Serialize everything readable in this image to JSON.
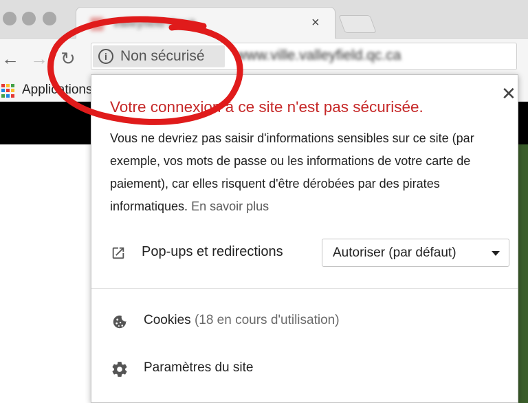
{
  "window": {
    "tab_title": "Valleyfield Capit",
    "tab_close_glyph": "×"
  },
  "toolbar": {
    "back_glyph": "←",
    "forward_glyph": "→",
    "reload_glyph": "↻",
    "security_chip_icon": "info-icon",
    "security_chip_label": "Non sécurisé",
    "url": "www.ville.valleyfield.qc.ca"
  },
  "bookmarks": {
    "apps_label": "Applications"
  },
  "popup": {
    "close_glyph": "✕",
    "title": "Votre connexion à ce site n'est pas sécurisée.",
    "body": "Vous ne devriez pas saisir d'informations sensibles sur ce site (par exemple, vos mots de passe ou les informations de votre carte de paiement), car elles risquent d'être dérobées par des pirates informatiques.",
    "learn_more": "En savoir plus",
    "permission": {
      "icon": "external-link-icon",
      "label": "Pop-ups et redirections",
      "value": "Autoriser (par défaut)"
    },
    "items": [
      {
        "icon": "cookie-icon",
        "label": "Cookies",
        "sub": "(18 en cours d'utilisation)"
      },
      {
        "icon": "gear-icon",
        "label": "Paramètres du site",
        "sub": ""
      }
    ]
  },
  "colors": {
    "warning_title": "#c62828",
    "annotation": "#e01b1b",
    "chrome_bg": "#dedede"
  }
}
